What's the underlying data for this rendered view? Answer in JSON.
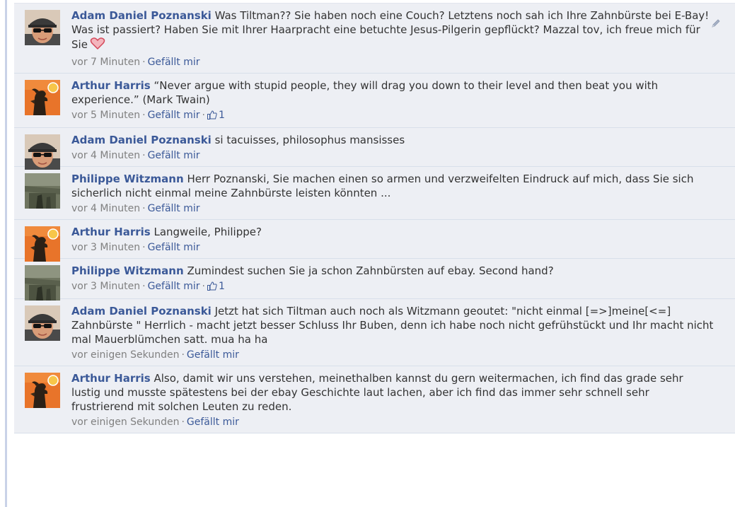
{
  "comments": [
    {
      "author": "Adam Daniel Poznanski",
      "avatar": "adam-avatar",
      "text": "Was Tiltman?? Sie haben noch eine Couch? Letztens noch sah ich Ihre Zahnbürste bei E-Bay! Was ist passiert? Haben Sie mit Ihrer Haarpracht eine betuchte Jesus-Pilgerin gepflückt? Mazzal tov, ich freue mich für Sie",
      "emoji": "heart-icon",
      "time": "vor 7 Minuten",
      "like_label": "Gefällt mir",
      "like_count": null,
      "edit_icon": "pencil-icon"
    },
    {
      "author": "Arthur Harris",
      "avatar": "arthur-avatar",
      "text": "“Never argue with stupid people, they will drag you down to their level and then beat you with experience.” (Mark Twain)",
      "time": "vor 5 Minuten",
      "like_label": "Gefällt mir",
      "like_count": "1"
    },
    {
      "author": "Adam Daniel Poznanski",
      "avatar": "adam-avatar",
      "text": "si tacuisses, philosophus mansisses",
      "time": "vor 4 Minuten",
      "like_label": "Gefällt mir",
      "like_count": null
    },
    {
      "author": "Philippe Witzmann",
      "avatar": "philippe-avatar",
      "text": "Herr Poznanski, Sie machen einen so armen und verzweifelten Eindruck auf mich, dass Sie sich sicherlich nicht einmal meine Zahnbürste leisten könnten ...",
      "time": "vor 4 Minuten",
      "like_label": "Gefällt mir",
      "like_count": null
    },
    {
      "author": "Arthur Harris",
      "avatar": "arthur-avatar",
      "text": "Langweile, Philippe?",
      "time": "vor 3 Minuten",
      "like_label": "Gefällt mir",
      "like_count": null
    },
    {
      "author": "Philippe Witzmann",
      "avatar": "philippe-avatar",
      "text": "Zumindest suchen Sie ja schon Zahnbürsten auf ebay. Second hand?",
      "time": "vor 3 Minuten",
      "like_label": "Gefällt mir",
      "like_count": "1"
    },
    {
      "author": "Adam Daniel Poznanski",
      "avatar": "adam-avatar",
      "text": "Jetzt hat sich Tiltman auch noch als Witzmann geoutet: \"nicht einmal [=>]meine[<=] Zahnbürste \" Herrlich - macht jetzt besser Schluss Ihr Buben, denn ich habe noch nicht gefrühstückt und Ihr macht nicht mal Mauerblümchen satt. mua ha ha",
      "time": "vor einigen Sekunden",
      "like_label": "Gefällt mir",
      "like_count": null
    },
    {
      "author": "Arthur Harris",
      "avatar": "arthur-avatar",
      "text": "Also, damit wir uns verstehen, meinethalben kannst du gern weitermachen, ich find das grade sehr lustig und musste spätestens bei der ebay Geschichte laut lachen, aber ich find das immer sehr schnell sehr frustrierend mit solchen Leuten zu reden.",
      "time": "vor einigen Sekunden",
      "like_label": "Gefällt mir",
      "like_count": null
    }
  ],
  "colors": {
    "link": "#3b5998",
    "meta": "#808080",
    "comment_bg": "#edeff4",
    "separator": "#d8dfea",
    "heart": "#e05a6a"
  }
}
